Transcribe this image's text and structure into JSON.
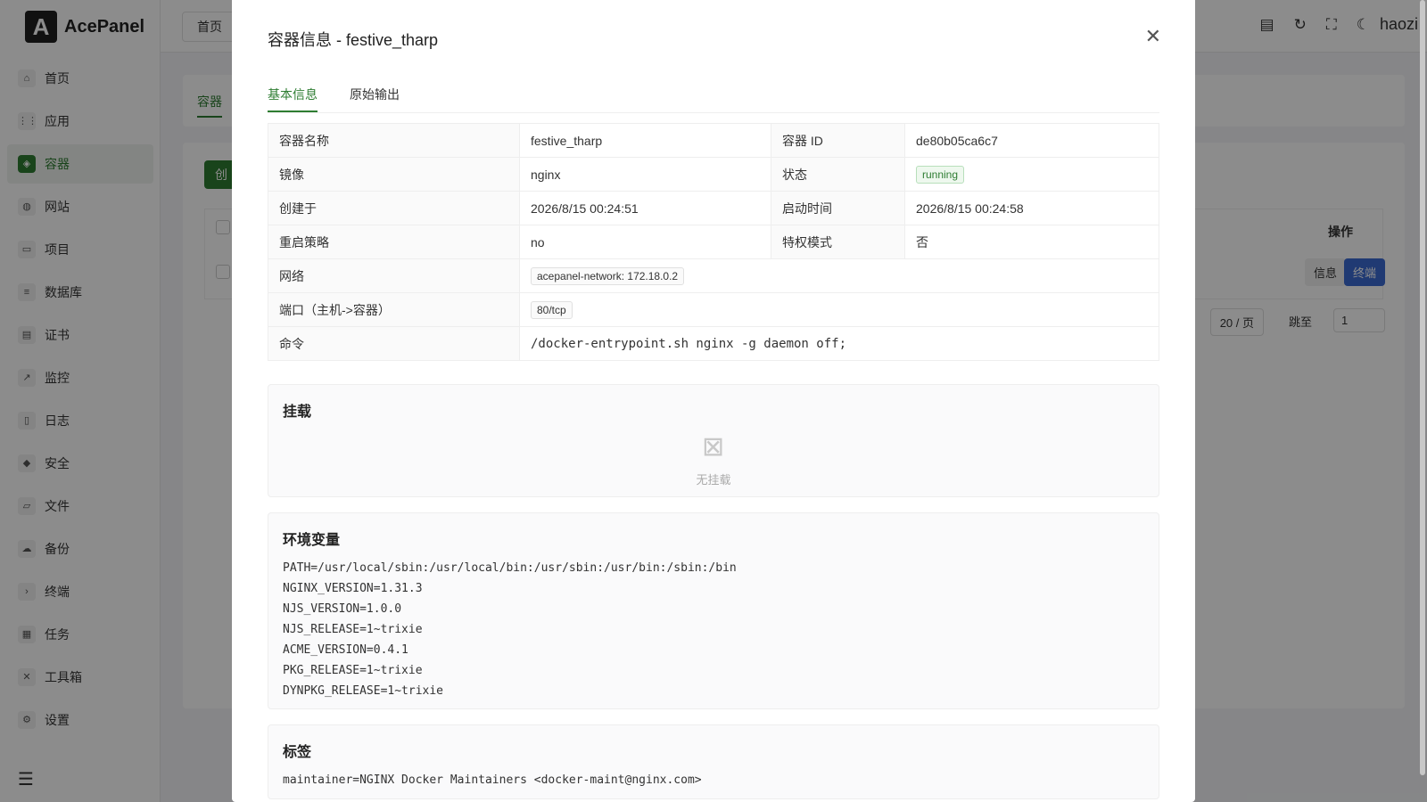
{
  "app": {
    "logo_letter": "A",
    "name": "AcePanel"
  },
  "sidebar": {
    "items": [
      {
        "label": "首页",
        "icon": "home-icon",
        "glyph": "⌂"
      },
      {
        "label": "应用",
        "icon": "apps-icon",
        "glyph": "⋮⋮"
      },
      {
        "label": "容器",
        "icon": "container-icon",
        "glyph": "◈",
        "active": true
      },
      {
        "label": "网站",
        "icon": "globe-icon",
        "glyph": "◍"
      },
      {
        "label": "项目",
        "icon": "project-icon",
        "glyph": "▭"
      },
      {
        "label": "数据库",
        "icon": "database-icon",
        "glyph": "≡"
      },
      {
        "label": "证书",
        "icon": "certificate-icon",
        "glyph": "▤"
      },
      {
        "label": "监控",
        "icon": "monitor-icon",
        "glyph": "↗"
      },
      {
        "label": "日志",
        "icon": "log-icon",
        "glyph": "▯"
      },
      {
        "label": "安全",
        "icon": "shield-icon",
        "glyph": "◆"
      },
      {
        "label": "文件",
        "icon": "folder-icon",
        "glyph": "▱"
      },
      {
        "label": "备份",
        "icon": "backup-icon",
        "glyph": "☁"
      },
      {
        "label": "终端",
        "icon": "terminal-icon",
        "glyph": "›"
      },
      {
        "label": "任务",
        "icon": "task-icon",
        "glyph": "▦"
      },
      {
        "label": "工具箱",
        "icon": "toolbox-icon",
        "glyph": "✕"
      },
      {
        "label": "设置",
        "icon": "settings-icon",
        "glyph": "⚙"
      }
    ]
  },
  "header": {
    "tab_label": "首页",
    "user": "haozi"
  },
  "background": {
    "tab_label": "容器",
    "create_btn": "创",
    "ops_header": "操作",
    "info_btn": "信息",
    "term_btn": "终端",
    "page_size": "20 / 页",
    "jump_label": "跳至",
    "jump_value": "1"
  },
  "modal": {
    "title": "容器信息 - festive_tharp",
    "tabs": [
      "基本信息",
      "原始输出"
    ],
    "rows": {
      "name_label": "容器名称",
      "name": "festive_tharp",
      "id_label": "容器 ID",
      "id": "de80b05ca6c7",
      "image_label": "镜像",
      "image": "nginx",
      "state_label": "状态",
      "state": "running",
      "created_label": "创建于",
      "created": "2026/8/15 00:24:51",
      "started_label": "启动时间",
      "started": "2026/8/15 00:24:58",
      "restart_label": "重启策略",
      "restart": "no",
      "privileged_label": "特权模式",
      "privileged": "否",
      "network_label": "网络",
      "network": "acepanel-network: 172.18.0.2",
      "ports_label": "端口（主机->容器）",
      "ports": "80/tcp",
      "command_label": "命令",
      "command": "/docker-entrypoint.sh nginx -g daemon off;"
    },
    "mounts": {
      "title": "挂载",
      "empty": "无挂载"
    },
    "env": {
      "title": "环境变量",
      "lines": [
        "PATH=/usr/local/sbin:/usr/local/bin:/usr/sbin:/usr/bin:/sbin:/bin",
        "NGINX_VERSION=1.31.3",
        "NJS_VERSION=1.0.0",
        "NJS_RELEASE=1~trixie",
        "ACME_VERSION=0.4.1",
        "PKG_RELEASE=1~trixie",
        "DYNPKG_RELEASE=1~trixie"
      ]
    },
    "labels": {
      "title": "标签",
      "lines": [
        "maintainer=NGINX Docker Maintainers <docker-maint@nginx.com>"
      ]
    }
  }
}
